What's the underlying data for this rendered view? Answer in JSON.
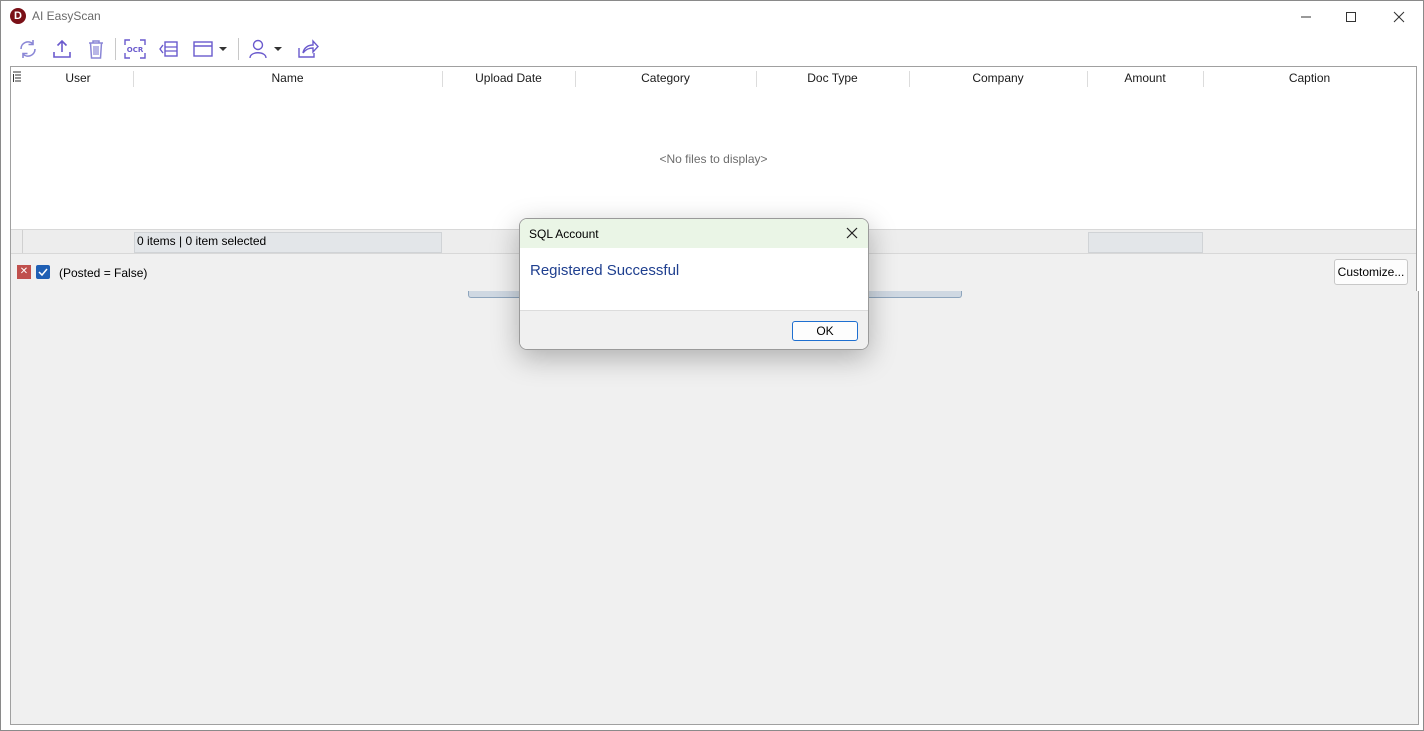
{
  "window": {
    "title": "AI EasyScan",
    "logo_letter": "D"
  },
  "toolbar": {
    "icons": [
      "refresh-icon",
      "upload-icon",
      "delete-icon",
      "ocr-icon",
      "panel-icon",
      "layout-icon",
      "dropdown-arrow-icon",
      "user-icon",
      "dropdown-arrow-icon",
      "share-icon"
    ]
  },
  "grid": {
    "columns": [
      "User",
      "Name",
      "Upload Date",
      "Category",
      "Doc Type",
      "Company",
      "Amount",
      "Caption"
    ],
    "empty_message": "<No files to display>",
    "footer": {
      "items_text": "0 items |  0 item selected"
    },
    "filter": {
      "text": "(Posted = False)",
      "customize_label": "Customize..."
    }
  },
  "dialog": {
    "title": "SQL Account",
    "message": "Registered Successful",
    "ok_label": "OK"
  },
  "colors": {
    "accent": "#6a5acd",
    "dialog_title_bg": "#eaf5e6",
    "message_text": "#1f3f8f",
    "logo": "#7a1017"
  }
}
